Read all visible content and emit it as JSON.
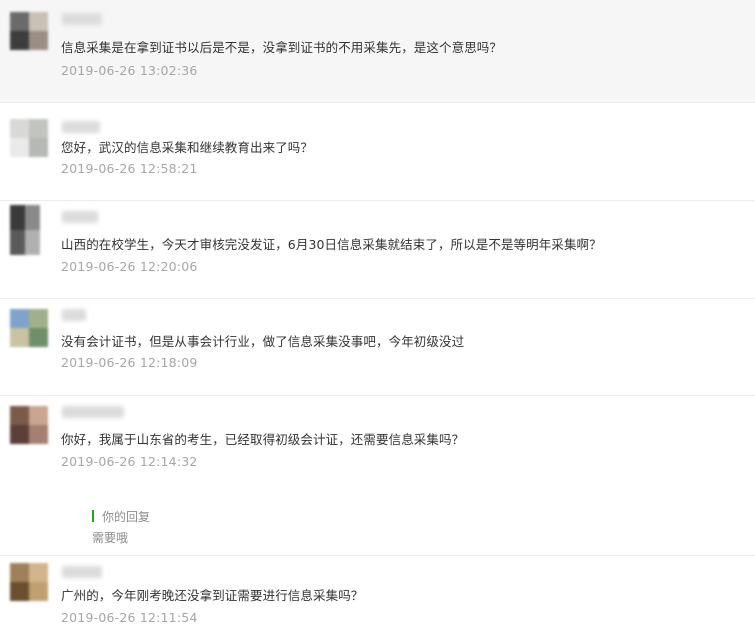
{
  "comments": [
    {
      "text": "信息采集是在拿到证书以后是不是，没拿到证书的不用采集先，是这个意思吗？",
      "time": "2019-06-26 13:02:36",
      "avatar_colors": [
        "#6a6a6a",
        "#c9c0b6",
        "#3d3d3d",
        "#9b8f85"
      ]
    },
    {
      "text": "您好，武汉的信息采集和继续教育出来了吗？",
      "time": "2019-06-26 12:58:21",
      "avatar_colors": [
        "#d8d8d6",
        "#c2c4c0",
        "#eaeaea",
        "#b6b8b4"
      ]
    },
    {
      "text": "山西的在校学生，今天才审核完没发证，6月30日信息采集就结束了，所以是不是等明年采集啊？",
      "time": "2019-06-26 12:20:06",
      "avatar_colors": [
        "#3a3a3a",
        "#8a8a8a",
        "#5a5a5a",
        "#b0b0b0"
      ]
    },
    {
      "text": "没有会计证书，但是从事会计行业，做了信息采集没事吧，今年初级没过",
      "time": "2019-06-26 12:18:09",
      "avatar_colors": [
        "#7fa3c9",
        "#9fb08a",
        "#c8c3a0",
        "#6f8f6a"
      ]
    },
    {
      "text": "你好，我属于山东省的考生，已经取得初级会计证，还需要信息采集吗？",
      "time": "2019-06-26 12:14:32",
      "avatar_colors": [
        "#7a5a4a",
        "#caa590",
        "#5a4038",
        "#a48070"
      ]
    },
    {
      "text": "广州的，今年刚考晚还没拿到证需要进行信息采集吗？",
      "time": "2019-06-26 12:11:54",
      "avatar_colors": [
        "#a0805a",
        "#d2b58a",
        "#6a5030",
        "#c0a070"
      ]
    }
  ],
  "reply": {
    "label": "你的回复",
    "text": "需要哦",
    "accent": "#1aad19"
  }
}
